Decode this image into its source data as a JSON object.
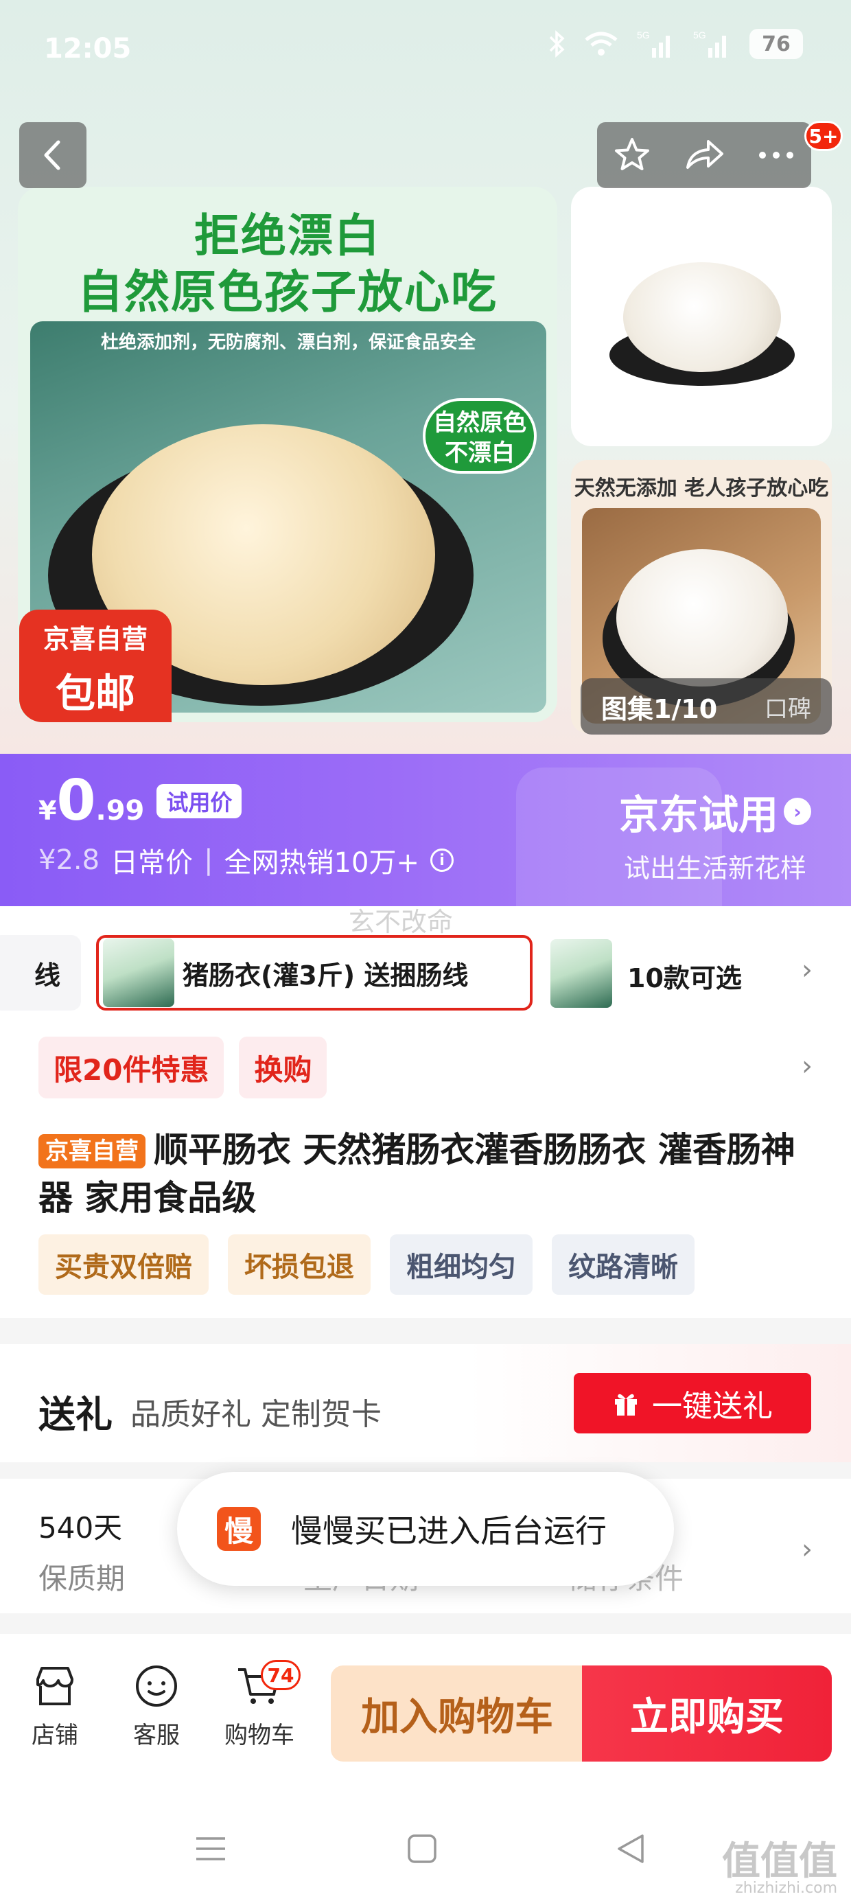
{
  "status_bar": {
    "time": "12:05",
    "battery": "76",
    "network_labels": [
      "5G",
      "5G"
    ]
  },
  "gallery": {
    "main_headline_1": "拒绝漂白",
    "main_headline_2": "自然原色孩子放心吃",
    "main_subline": "杜绝添加剂，无防腐剂、漂白剂，保证食品安全",
    "main_bubble_1": "自然原色",
    "main_bubble_2": "不漂白",
    "jx_tag_1": "京喜自营",
    "jx_tag_2": "包邮",
    "side2_caption": "天然无添加 老人孩子放心吃",
    "counter": "图集1/10",
    "koubei": "口碑",
    "more_badge": "5+"
  },
  "trial": {
    "yen": "¥",
    "price_int": "0",
    "price_dec": ".99",
    "price_label": "试用价",
    "regular_price": "¥2.8",
    "regular_label": "日常价",
    "hot_sales": "全网热销10万+",
    "brand_title": "京东试用",
    "brand_slogan": "试出生活新花样"
  },
  "watermark": "玄不改命",
  "variants": {
    "partial_left": "线",
    "selected": "猪肠衣(灌3斤) 送捆肠线",
    "more": "10款可选"
  },
  "promos": [
    "限20件特惠",
    "换购"
  ],
  "product": {
    "store_badge": "京喜自营",
    "title": "顺平肠衣 天然猪肠衣灌香肠肠衣 灌香肠神器 家用食品级",
    "tags_warm": [
      "买贵双倍赔",
      "坏损包退"
    ],
    "tags_cool": [
      "粗细均匀",
      "纹路清晰"
    ]
  },
  "gift": {
    "heading": "送礼",
    "desc": "品质好礼 定制贺卡",
    "button": "一键送礼"
  },
  "shelf": {
    "value": "540天",
    "label": "保质期",
    "label2": "生产日期",
    "label3": "储存条件"
  },
  "toast": {
    "icon": "慢",
    "text": "慢慢买已进入后台运行"
  },
  "bottom_bar": {
    "store": "店铺",
    "service": "客服",
    "cart": "购物车",
    "cart_count": "74",
    "add_to_cart": "加入购物车",
    "buy_now": "立即购买"
  },
  "site_watermark": {
    "big": "值值值",
    "small": "zhizhizhi.com"
  },
  "colors": {
    "accent_red": "#e1251b",
    "trial_purple": "#8a5cf6",
    "jx_orange": "#f2731b"
  }
}
